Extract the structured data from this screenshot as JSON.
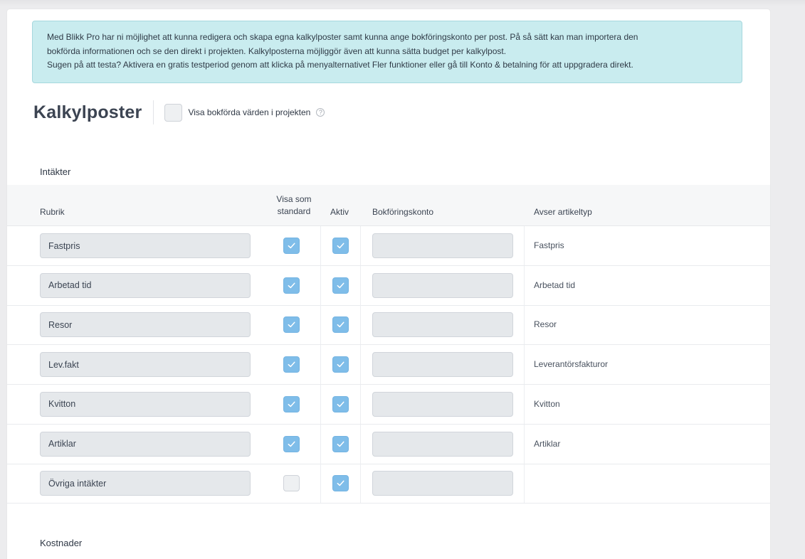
{
  "info": {
    "lines": [
      "Med Blikk Pro har ni möjlighet att kunna redigera och skapa egna kalkylposter samt kunna ange bokföringskonto per post. På så sätt kan man importera den",
      "bokförda informationen och se den direkt i projekten. Kalkylposterna möjliggör även att kunna sätta budget per kalkylpost.",
      "Sugen på att testa? Aktivera en gratis testperiod genom att klicka på menyalternativet Fler funktioner eller gå till Konto & betalning för att uppgradera direkt."
    ]
  },
  "page": {
    "title": "Kalkylposter",
    "show_booked_label": "Visa bokförda värden i projekten",
    "show_booked_checked": false,
    "help_glyph": "?",
    "help_icon": "question-circle-icon"
  },
  "colors": {
    "info_bg": "#c9ecef",
    "checkbox_on": "#7fbde9",
    "input_bg": "#e5e8eb"
  },
  "income": {
    "section_title": "Intäkter",
    "columns": {
      "rubrik": "Rubrik",
      "visa_som_line1": "Visa som",
      "visa_som_line2": "standard",
      "aktiv": "Aktiv",
      "bokforingskonto": "Bokföringskonto",
      "avser": "Avser artikeltyp"
    },
    "rows": [
      {
        "name": "Fastpris",
        "standard": true,
        "active": true,
        "account": "",
        "type": "Fastpris"
      },
      {
        "name": "Arbetad tid",
        "standard": true,
        "active": true,
        "account": "",
        "type": "Arbetad tid"
      },
      {
        "name": "Resor",
        "standard": true,
        "active": true,
        "account": "",
        "type": "Resor"
      },
      {
        "name": "Lev.fakt",
        "standard": true,
        "active": true,
        "account": "",
        "type": "Leverantörsfakturor"
      },
      {
        "name": "Kvitton",
        "standard": true,
        "active": true,
        "account": "",
        "type": "Kvitton"
      },
      {
        "name": "Artiklar",
        "standard": true,
        "active": true,
        "account": "",
        "type": "Artiklar"
      },
      {
        "name": "Övriga intäkter",
        "standard": false,
        "active": true,
        "account": "",
        "type": ""
      }
    ]
  },
  "costs": {
    "section_title": "Kostnader"
  }
}
